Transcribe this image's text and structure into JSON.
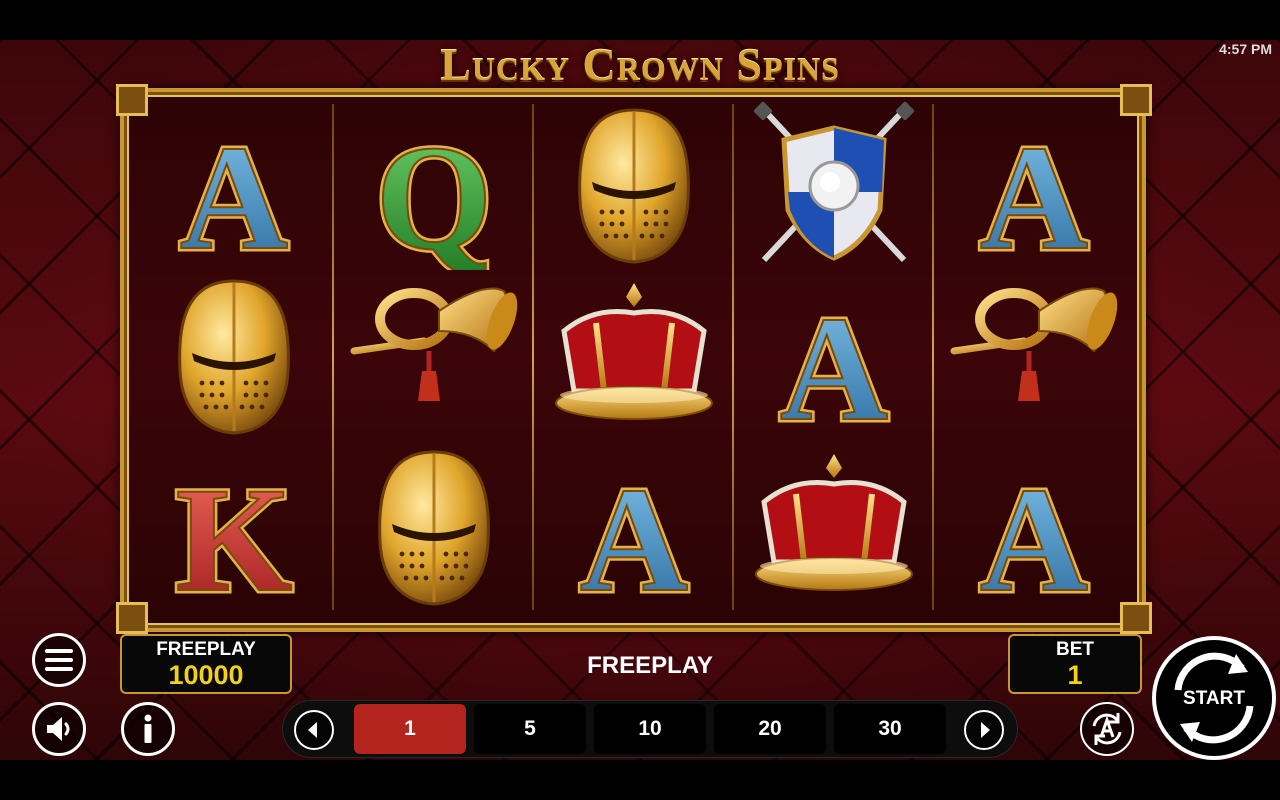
{
  "status_bar": {
    "time": "4:57 PM"
  },
  "game": {
    "title": "Lucky Crown Spins"
  },
  "reels": [
    [
      "ace",
      "helmet",
      "king"
    ],
    [
      "queen",
      "horn",
      "helmet"
    ],
    [
      "helmet",
      "crown",
      "ace"
    ],
    [
      "shield",
      "ace",
      "crown"
    ],
    [
      "ace",
      "horn",
      "ace"
    ]
  ],
  "letters": {
    "ace": "A",
    "queen": "Q",
    "king": "K"
  },
  "balance": {
    "label": "FREEPLAY",
    "value": "10000"
  },
  "bet": {
    "label": "BET",
    "value": "1"
  },
  "mode_label": "FREEPLAY",
  "bet_options": [
    "1",
    "5",
    "10",
    "20",
    "30"
  ],
  "selected_bet": "1",
  "start_label": "START",
  "colors": {
    "gold": "#c9972f",
    "yellow": "#f2d11a",
    "selected": "#b3241e",
    "background": "#4a080c"
  },
  "icons": [
    "menu-icon",
    "sound-icon",
    "info-icon",
    "autoplay-icon",
    "prev-arrow-icon",
    "next-arrow-icon",
    "spin-arrows-icon"
  ]
}
